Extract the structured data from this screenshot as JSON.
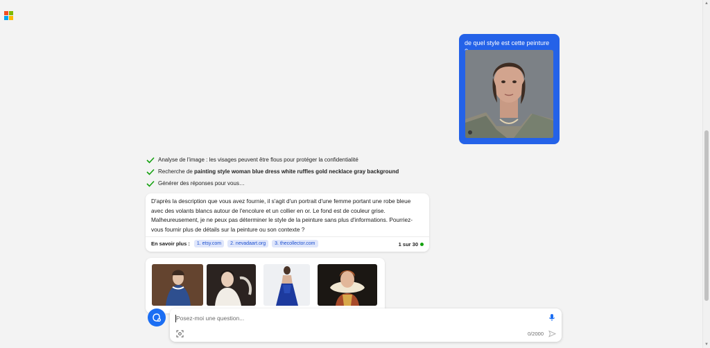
{
  "brand": {
    "logo_colors": [
      "#f25022",
      "#7fba00",
      "#00a4ef",
      "#ffb900"
    ]
  },
  "user_message": {
    "text": "de quel style est cette peinture ?"
  },
  "steps": [
    {
      "text": "Analyse de l'image : les visages peuvent être flous pour protéger la confidentialité"
    },
    {
      "prefix": "Recherche de ",
      "bold": "painting style woman blue dress white ruffles gold necklace gray background"
    },
    {
      "text": "Générer des réponses pour vous…"
    }
  ],
  "answer": {
    "text": "D'après la description que vous avez fournie, il s'agit d'un portrait d'une femme portant une robe bleue avec des volants blancs autour de l'encolure et un collier en or. Le fond est de couleur grise. Malheureusement, je ne peux pas déterminer le style de la peinture sans plus d'informations. Pourriez-vous fournir plus de détails sur la peinture ou son contexte ?",
    "learn_more_label": "En savoir plus :",
    "sources": [
      "1. etsy.com",
      "2. nevadaart.org",
      "3. thecollector.com"
    ],
    "page_count": "1 sur 30"
  },
  "input": {
    "placeholder": "Posez-moi une question...",
    "char_count": "0/2000"
  },
  "colors": {
    "accent": "#2462e8",
    "check": "#13a10e"
  }
}
